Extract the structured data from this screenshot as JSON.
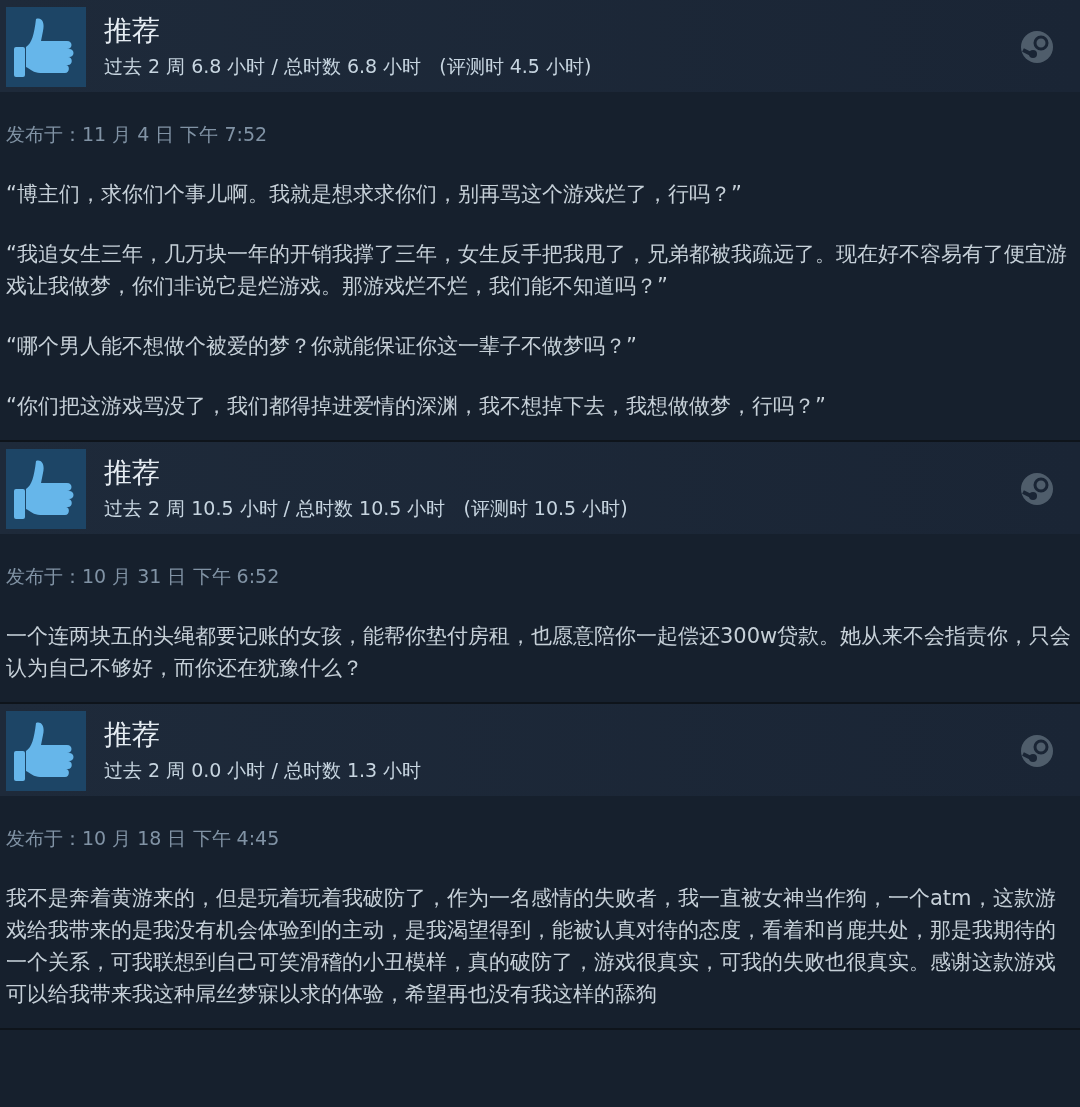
{
  "reviews": [
    {
      "recommendation": "推荐",
      "hours": "过去 2 周 6.8 小时 / 总时数 6.8 小时",
      "review_hours": "(评测时 4.5 小时)",
      "posted": "发布于：11 月 4 日 下午 7:52",
      "paragraphs": [
        "“博主们，求你们个事儿啊。我就是想求求你们，别再骂这个游戏烂了，行吗？”",
        "“我追女生三年，几万块一年的开销我撑了三年，女生反手把我甩了，兄弟都被我疏远了。现在好不容易有了便宜游戏让我做梦，你们非说它是烂游戏。那游戏烂不烂，我们能不知道吗？”",
        "“哪个男人能不想做个被爱的梦？你就能保证你这一辈子不做梦吗？”",
        "“你们把这游戏骂没了，我们都得掉进爱情的深渊，我不想掉下去，我想做做梦，行吗？”"
      ]
    },
    {
      "recommendation": "推荐",
      "hours": "过去 2 周 10.5 小时 / 总时数 10.5 小时",
      "review_hours": "(评测时 10.5 小时)",
      "posted": "发布于：10 月 31 日 下午 6:52",
      "paragraphs": [
        "一个连两块五的头绳都要记账的女孩，能帮你垫付房租，也愿意陪你一起偿还300w贷款。她从来不会指责你，只会认为自己不够好，而你还在犹豫什么？"
      ]
    },
    {
      "recommendation": "推荐",
      "hours": "过去 2 周 0.0 小时 / 总时数 1.3 小时",
      "posted": "发布于：10 月 18 日 下午 4:45",
      "paragraphs": [
        "我不是奔着黄游来的，但是玩着玩着我破防了，作为一名感情的失败者，我一直被女神当作狗，一个atm，这款游戏给我带来的是我没有机会体验到的主动，是我渴望得到，能被认真对待的态度，看着和肖鹿共处，那是我期待的一个关系，可我联想到自己可笑滑稽的小丑模样，真的破防了，游戏很真实，可我的失败也很真实。感谢这款游戏可以给我带来我这种屌丝梦寐以求的体验，希望再也没有我这样的舔狗"
      ]
    }
  ]
}
